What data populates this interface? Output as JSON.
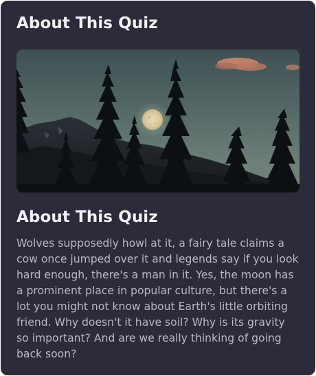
{
  "card": {
    "title": "About This Quiz",
    "image": {
      "subject": "full-moon-behind-pine-silhouettes"
    },
    "heading": "About This Quiz",
    "description": "Wolves supposedly howl at it, a fairy tale claims a cow once jumped over it and legends say if you look hard enough, there's a man in it. Yes, the moon has a prominent place in popular culture, but there's a lot you might not know about Earth's little orbiting friend. Why doesn't it have soil? Why is its gravity so important? And are we really thinking of going back soon?"
  },
  "colors": {
    "card_background": "#2c2b3a",
    "heading_text": "#f2f2f5",
    "body_text": "#b9b8c4"
  }
}
